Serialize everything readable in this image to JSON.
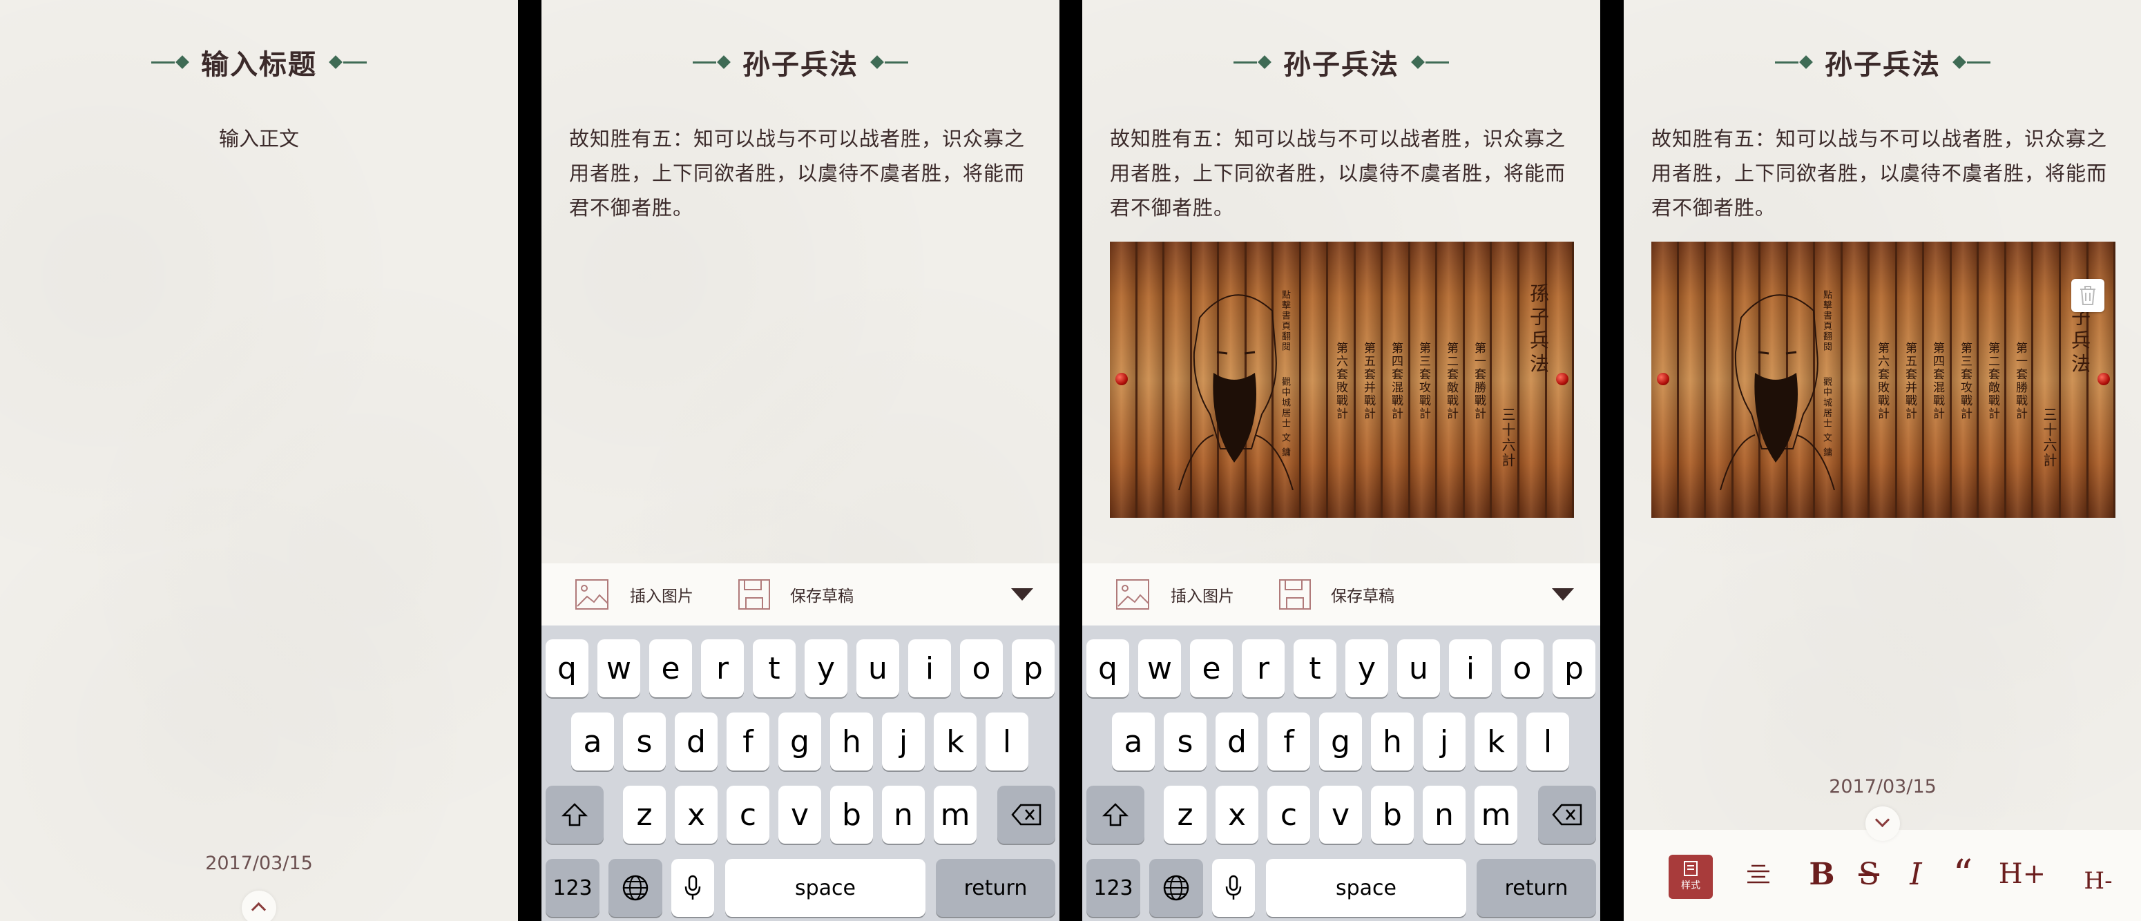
{
  "screen1": {
    "title": "输入标题",
    "body_placeholder": "输入正文",
    "date": "2017/03/15"
  },
  "screen2": {
    "title": "孙子兵法",
    "body": "故知胜有五：知可以战与不可以战者胜，识众寡之用者胜，上下同欲者胜，以虞待不虞者胜，将能而君不御者胜。",
    "toolbar": {
      "insert_image": "插入图片",
      "save_draft": "保存草稿"
    },
    "keyboard": {
      "row1": [
        "q",
        "w",
        "e",
        "r",
        "t",
        "y",
        "u",
        "i",
        "o",
        "p"
      ],
      "row2": [
        "a",
        "s",
        "d",
        "f",
        "g",
        "h",
        "j",
        "k",
        "l"
      ],
      "row3": [
        "z",
        "x",
        "c",
        "v",
        "b",
        "n",
        "m"
      ],
      "num_key": "123",
      "space": "space",
      "return": "return"
    }
  },
  "screen3": {
    "title": "孙子兵法",
    "body": "故知胜有五：知可以战与不可以战者胜，识众寡之用者胜，上下同欲者胜，以虞待不虞者胜，将能而君不御者胜。",
    "image_text": {
      "big_title": "孫子兵法",
      "columns": [
        "第六套敗戰計",
        "第五套并戰計",
        "第四套混戰計",
        "第三套攻戰計",
        "第二套敵戰計",
        "第一套勝戰計"
      ],
      "subtitle": "三十六計",
      "side_note": "點擊書頁翻閱",
      "author_note": "觀中城居士 文 鏞"
    },
    "toolbar": {
      "insert_image": "插入图片",
      "save_draft": "保存草稿"
    },
    "keyboard": {
      "row1": [
        "q",
        "w",
        "e",
        "r",
        "t",
        "y",
        "u",
        "i",
        "o",
        "p"
      ],
      "row2": [
        "a",
        "s",
        "d",
        "f",
        "g",
        "h",
        "j",
        "k",
        "l"
      ],
      "row3": [
        "z",
        "x",
        "c",
        "v",
        "b",
        "n",
        "m"
      ],
      "num_key": "123",
      "space": "space",
      "return": "return"
    }
  },
  "screen4": {
    "title": "孙子兵法",
    "body": "故知胜有五：知可以战与不可以战者胜，识众寡之用者胜，上下同欲者胜，以虞待不虞者胜，将能而君不御者胜。",
    "date": "2017/03/15",
    "format_bar": {
      "style_label": "样式",
      "bold": "B",
      "strike": "S",
      "italic": "I",
      "quote": "“",
      "h_plus": "H+",
      "h_minus": "H-"
    }
  },
  "colors": {
    "accent_red": "#a83b3b",
    "ornament_green": "#3f6b55",
    "text_brown": "#3b2a2a"
  }
}
